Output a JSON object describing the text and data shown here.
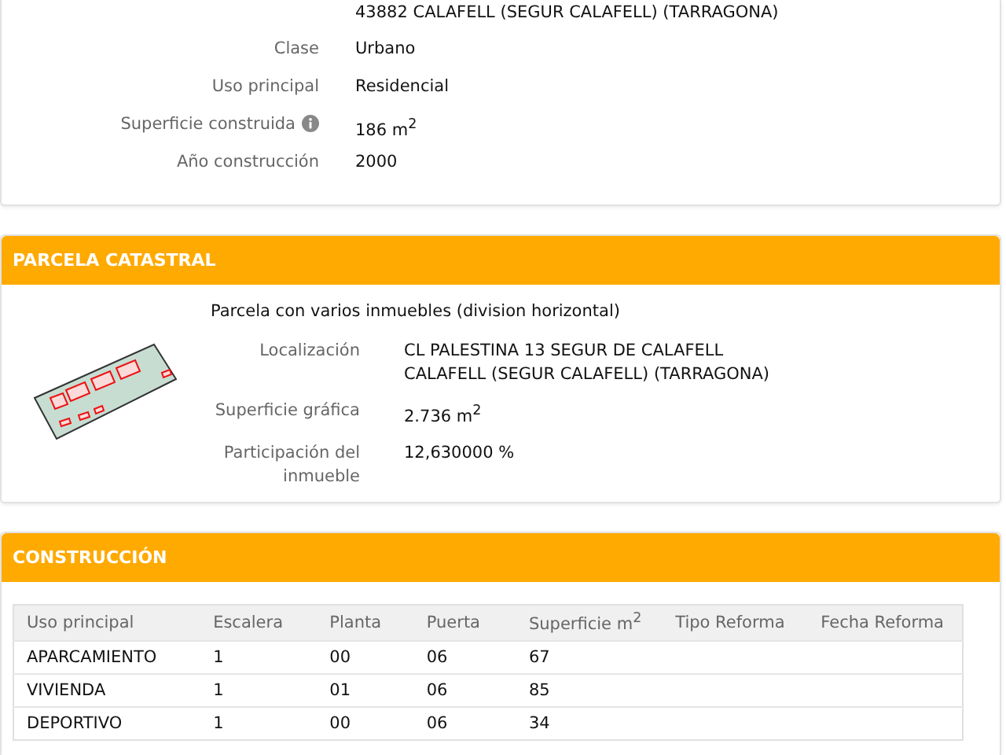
{
  "inmueble": {
    "address_line": "43882 CALAFELL (SEGUR CALAFELL) (TARRAGONA)",
    "fields": [
      {
        "label": "Clase",
        "value": "Urbano",
        "info": false
      },
      {
        "label": "Uso principal",
        "value": "Residencial",
        "info": false
      },
      {
        "label": "Superficie construida",
        "value": "186 m$^{2}$",
        "info": true
      },
      {
        "label": "Año construcción",
        "value": "2000",
        "info": false
      }
    ]
  },
  "parcela": {
    "title": "PARCELA CATASTRAL",
    "description": "Parcela con varios inmuebles (division horizontal)",
    "fields": [
      {
        "label": "Localización",
        "value": [
          "CL PALESTINA 13 SEGUR DE CALAFELL",
          "CALAFELL (SEGUR CALAFELL) (TARRAGONA)"
        ]
      },
      {
        "label": "Superficie gráfica",
        "value": [
          "2.736 m$^{2}$"
        ]
      },
      {
        "label": "Participación del inmueble",
        "value": [
          "12,630000 %"
        ]
      }
    ]
  },
  "construccion": {
    "title": "CONSTRUCCIÓN",
    "columns": [
      "Uso principal",
      "Escalera",
      "Planta",
      "Puerta",
      "Superficie m$^{2}$",
      "Tipo Reforma",
      "Fecha Reforma"
    ],
    "rows": [
      [
        "APARCAMIENTO",
        "1",
        "00",
        "06",
        "67",
        "",
        ""
      ],
      [
        "VIVIENDA",
        "1",
        "01",
        "06",
        "85",
        "",
        ""
      ],
      [
        "DEPORTIVO",
        "1",
        "00",
        "06",
        "34",
        "",
        ""
      ]
    ]
  }
}
